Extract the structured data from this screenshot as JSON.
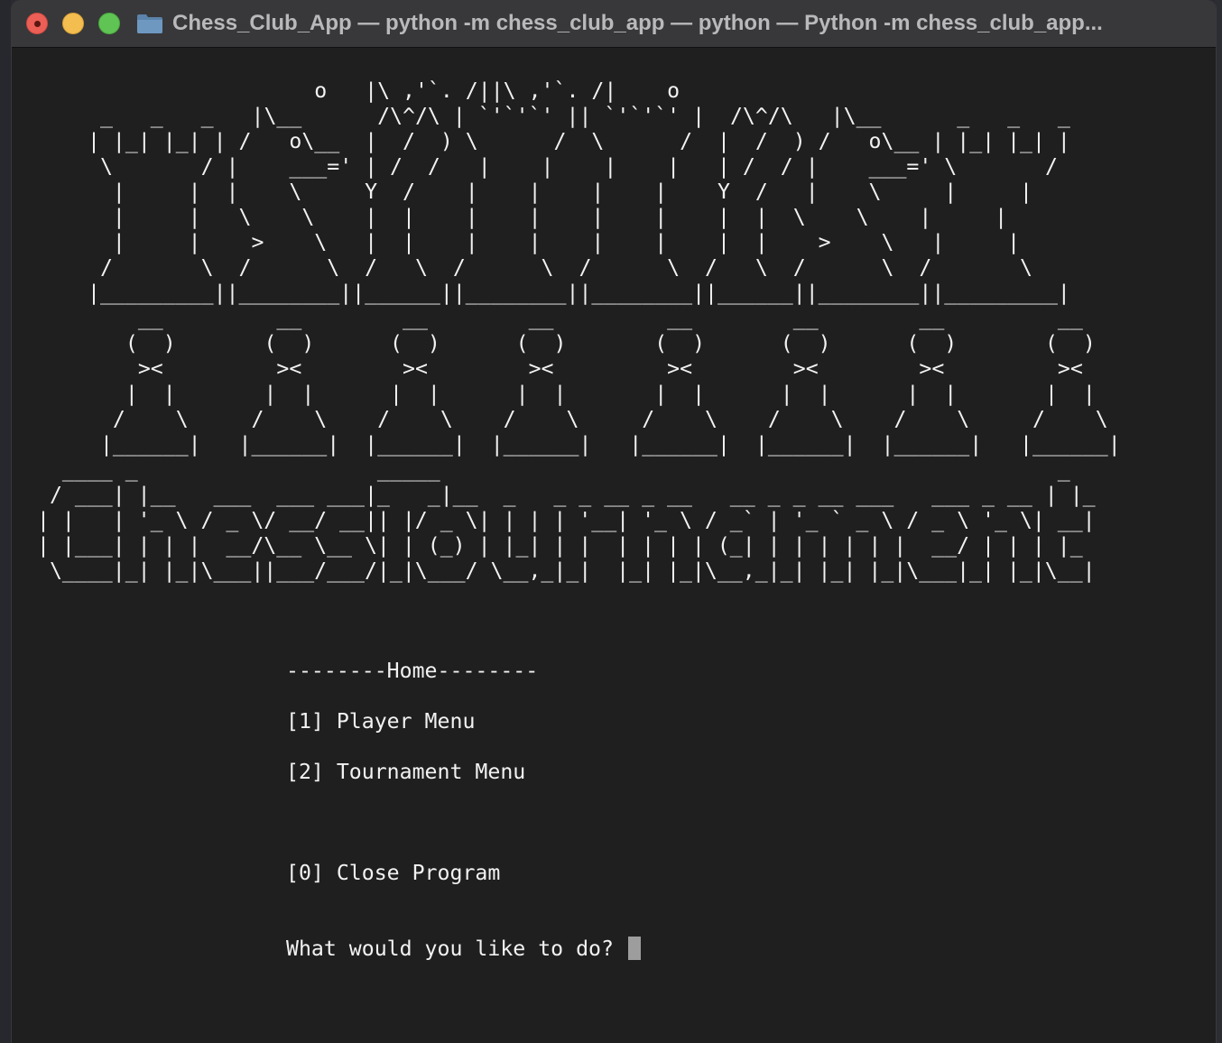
{
  "window": {
    "title": "Chess_Club_App — python -m chess_club_app — python — Python -m chess_club_app..."
  },
  "colors": {
    "terminal_background": "#1f1f1f",
    "text": "#f2f2f2",
    "titlebar": "#38383a",
    "close": "#ec5f56",
    "minimize": "#f4bd4f",
    "zoom": "#5fc454"
  },
  "icons": {
    "title": "folder-icon",
    "close": "close-icon",
    "minimize": "minimize-icon",
    "zoom": "zoom-icon"
  },
  "banner": {
    "pieces_art": "                  o   |\\ ,'`. /||\\ ,'`. /|    o\n _   _   _   |\\__      /\\^/\\ | `'`'`' || `'`'`' |  /\\^/\\   |\\__      _   _   _\n| |_| |_| | /   o\\__  |  /  ) \\      /  \\      /  |  /  ) /   o\\__ | |_| |_| |\n \\       / |    ___=' | /  /   |    |    |    |   | /  / |    ___=' \\       /\n  |     |  |    \\     Y  /    |    |    |    |    Y  /   |    \\     |     |\n  |     |   \\    \\    |  |    |    |    |    |    |  |  \\    \\    |     |\n  |     |    >    \\   |  |    |    |    |    |    |  |    >    \\   |     |\n /       \\  /      \\  /   \\  /      \\  /      \\  /   \\  /      \\  /       \\\n|_________||________||______||________||________||______||________||_________|",
    "pawns_art": "    __         __        __        __         __        __        __         __\n   (  )       (  )      (  )      (  )       (  )      (  )      (  )       (  )\n    ><         ><        ><        ><         ><        ><        ><         ><\n   |  |       |  |      |  |      |  |       |  |      |  |      |  |       |  |\n  /    \\     /    \\    /    \\    /    \\     /    \\    /    \\    /    \\     /    \\\n |______|   |______|  |______|  |______|   |______|  |______|  |______|   |______|",
    "title_art": "  ____ _                   _____                                                 _\n / ___| |__   ___  ___ ___|_   _|__  _   _ _ __ _ __   __ _ _ __ ___   ___ _ __ | |_\n| |   | '_ \\ / _ \\/ __/ __|| |/ _ \\| | | | '__| '_ \\ / _` | '_ ` _ \\ / _ \\ '_ \\| __|\n| |___| | | |  __/\\__ \\__ \\| | (_) | |_| | |  | | | | (_| | | | | | |  __/ | | | |_\n \\____|_| |_|\\___||___/___/|_|\\___/ \\__,_|_|  |_| |_|\\__,_|_| |_| |_|\\___|_| |_|\\__|"
  },
  "menu": {
    "header": "--------Home--------",
    "options": [
      "[1] Player Menu",
      "[2] Tournament Menu",
      "[0] Close Program"
    ],
    "prompt": "What would you like to do? "
  }
}
